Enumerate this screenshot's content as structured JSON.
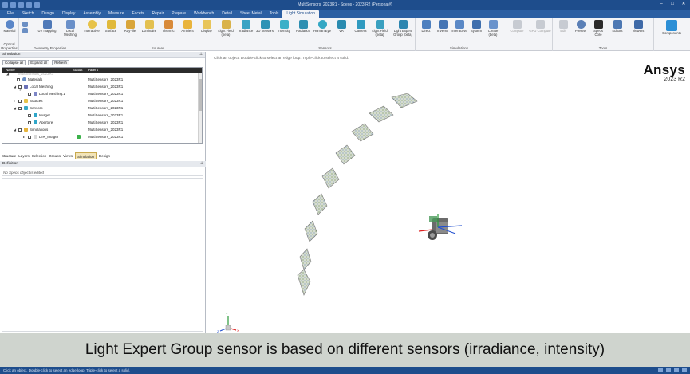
{
  "window": {
    "title": "MultiSensors_2023R1 - Speos - 2023 R2 (Personal#)"
  },
  "ribbon": {
    "tabs": [
      "File",
      "Sketch",
      "Design",
      "Display",
      "Assembly",
      "Measure",
      "Facets",
      "Repair",
      "Prepare",
      "Workbench",
      "Detail",
      "Sheet Metal",
      "Tools",
      "Light Simulation"
    ],
    "active_tab": "Light Simulation",
    "groups": [
      {
        "label": "Optical Properties",
        "buttons": [
          "Material"
        ]
      },
      {
        "label": "Geometry Properties",
        "buttons": [
          "UV mapping",
          "Local Meshing"
        ]
      },
      {
        "label": "Sources",
        "buttons": [
          "Interactive",
          "Surface",
          "Ray-file",
          "Luminaire",
          "Thermic",
          "Ambient",
          "Display",
          "Light Field (beta)"
        ]
      },
      {
        "label": "Sensors",
        "buttons": [
          "Irradiance",
          "3D Sensors",
          "Intensity",
          "Radiance",
          "Human Eye",
          "VR",
          "Camera",
          "Light Field (beta)",
          "Light Expert Group (beta)"
        ]
      },
      {
        "label": "Simulations",
        "buttons": [
          "Direct",
          "Inverse",
          "Interactive",
          "System",
          "Create (beta)"
        ]
      },
      {
        "label": "",
        "buttons": [
          "Compute",
          "GPU Compute"
        ]
      },
      {
        "label": "Tools",
        "buttons": [
          "Edit",
          "Presets",
          "Speos Core",
          "Editors",
          "Viewers"
        ]
      },
      {
        "label": "",
        "buttons": [
          "Components"
        ]
      }
    ]
  },
  "simulation_panel": {
    "title": "Simulation",
    "toolbar": [
      "Collapse all",
      "Expand all",
      "Refresh"
    ],
    "columns": [
      "Name",
      "Status",
      "Parent"
    ],
    "rows": [
      {
        "name": "MultiSensors_2023R1",
        "parent": ""
      },
      {
        "name": "Materials",
        "parent": "MultiSensors_2023R1"
      },
      {
        "name": "Local Meshing",
        "parent": "MultiSensors_2023R1"
      },
      {
        "name": "Local Meshing.1",
        "parent": "MultiSensors_2023R1"
      },
      {
        "name": "Sources",
        "parent": "MultiSensors_2023R1"
      },
      {
        "name": "Sensors",
        "parent": "MultiSensors_2023R1"
      },
      {
        "name": "Imager",
        "parent": "MultiSensors_2023R1"
      },
      {
        "name": "Aperture",
        "parent": "MultiSensors_2023R1"
      },
      {
        "name": "Simulations",
        "parent": "MultiSensors_2023R1"
      },
      {
        "name": "DIR_Imager",
        "parent": "MultiSensors_2023R1"
      }
    ],
    "bottom_tabs": [
      "Structure",
      "Layers",
      "Selection",
      "Groups",
      "Views",
      "Simulation",
      "Design"
    ],
    "active_bottom_tab": "Simulation"
  },
  "definition_panel": {
    "title": "Definition",
    "message": "No Speos object is edited"
  },
  "viewport": {
    "hint": "Click an object. Double-click to select an edge loop. Triple-click to select a solid.",
    "brand": "Ansys",
    "version": "2023 R2",
    "axis_labels": [
      "X",
      "Y",
      "Z"
    ]
  },
  "caption": "Light Expert Group sensor is based on different sensors (irradiance, intensity)",
  "statusbar": {
    "text": "Click an object. Double-click to select an edge loop. Triple-click to select a solid."
  },
  "colors": {
    "titlebar": "#1e4d8c",
    "tabbar": "#2b5fa3",
    "sensor_fill": "#d6dccf",
    "caption_bg": "#cfd4ce"
  }
}
